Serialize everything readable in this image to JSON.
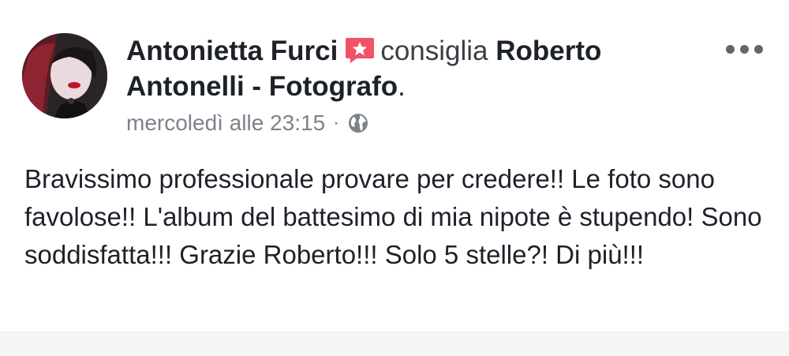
{
  "post": {
    "author": "Antonietta Furci",
    "action_text": "consiglia",
    "page_name": "Roberto Antonelli - Fotografo",
    "page_suffix": ".",
    "timestamp": "mercoledì alle 23:15",
    "separator": "·",
    "privacy_icon": "globe-icon",
    "recommend_icon": "recommendation-star-icon",
    "menu_icon": "more-options-icon",
    "body": "Bravissimo professionale provare per credere!! Le foto sono favolose!! L'album del battesimo di mia nipote è stupendo! Sono soddisfatta!!! Grazie Roberto!!! Solo 5 stelle?! Di più!!!"
  },
  "colors": {
    "text": "#1d2129",
    "meta": "#7d828a",
    "badge": "#f25268"
  }
}
